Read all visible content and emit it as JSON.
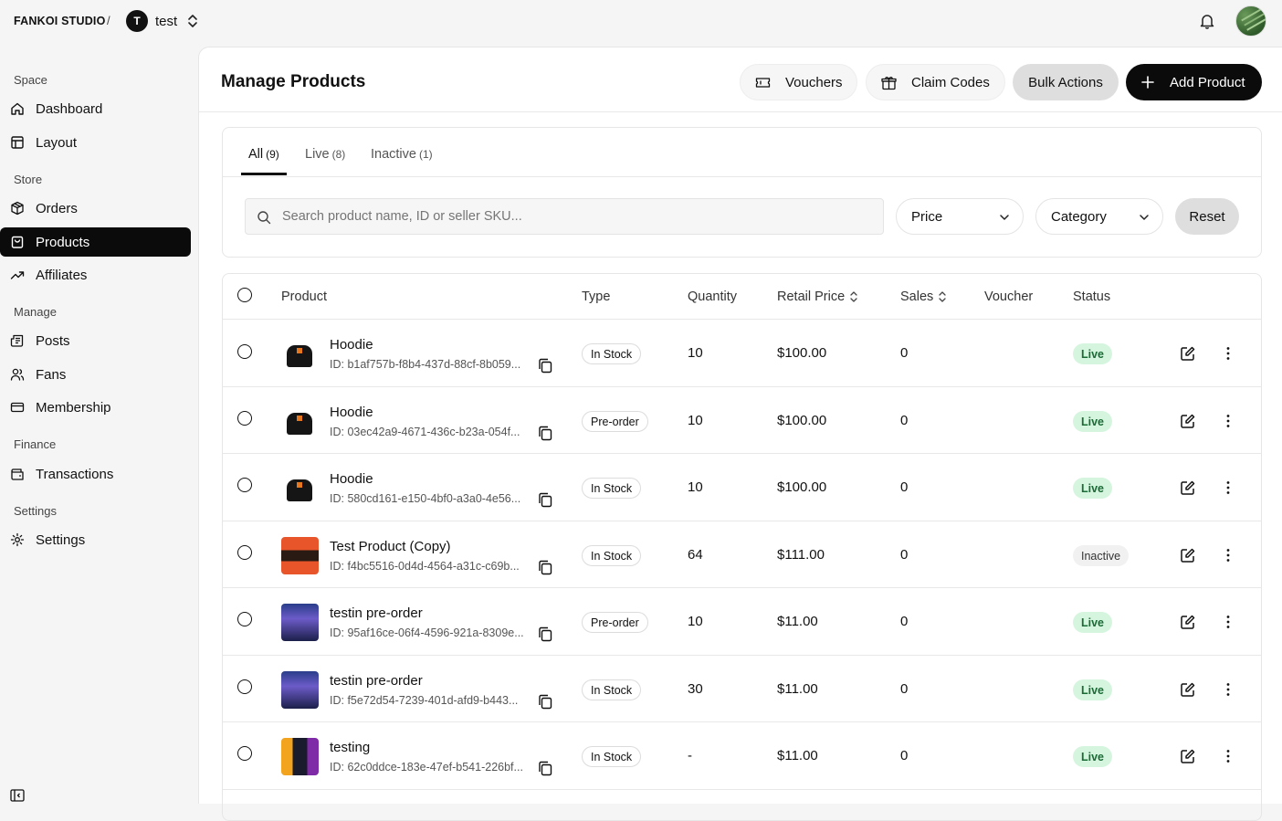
{
  "topbar": {
    "brand": "FANKOI STUDIO",
    "separator": "/",
    "space_initial": "T",
    "space_name": "test"
  },
  "sidebar": {
    "sections": [
      {
        "label": "Space"
      },
      {
        "label": "Store"
      },
      {
        "label": "Manage"
      },
      {
        "label": "Finance"
      },
      {
        "label": "Settings"
      }
    ],
    "items": [
      {
        "label": "Dashboard"
      },
      {
        "label": "Layout"
      },
      {
        "label": "Orders"
      },
      {
        "label": "Products"
      },
      {
        "label": "Affiliates"
      },
      {
        "label": "Posts"
      },
      {
        "label": "Fans"
      },
      {
        "label": "Membership"
      },
      {
        "label": "Transactions"
      },
      {
        "label": "Settings"
      }
    ]
  },
  "header": {
    "title": "Manage Products",
    "vouchers_label": "Vouchers",
    "claim_codes_label": "Claim Codes",
    "bulk_actions_label": "Bulk Actions",
    "add_product_label": "Add Product"
  },
  "tabs": [
    {
      "label": "All",
      "count": "(9)"
    },
    {
      "label": "Live",
      "count": "(8)"
    },
    {
      "label": "Inactive",
      "count": "(1)"
    }
  ],
  "filters": {
    "search_placeholder": "Search product name, ID or seller SKU...",
    "price_label": "Price",
    "category_label": "Category",
    "reset_label": "Reset"
  },
  "table": {
    "columns": {
      "product": "Product",
      "type": "Type",
      "quantity": "Quantity",
      "retail_price": "Retail Price",
      "sales": "Sales",
      "voucher": "Voucher",
      "status": "Status"
    },
    "rows": [
      {
        "name": "Hoodie",
        "id": "ID: b1af757b-f8b4-437d-88cf-8b059...",
        "type": "In Stock",
        "quantity": "10",
        "price": "$100.00",
        "sales": "0",
        "status": "Live"
      },
      {
        "name": "Hoodie",
        "id": "ID: 03ec42a9-4671-436c-b23a-054f...",
        "type": "Pre-order",
        "quantity": "10",
        "price": "$100.00",
        "sales": "0",
        "status": "Live"
      },
      {
        "name": "Hoodie",
        "id": "ID: 580cd161-e150-4bf0-a3a0-4e56...",
        "type": "In Stock",
        "quantity": "10",
        "price": "$100.00",
        "sales": "0",
        "status": "Live"
      },
      {
        "name": "Test Product (Copy)",
        "id": "ID: f4bc5516-0d4d-4564-a31c-c69b...",
        "type": "In Stock",
        "quantity": "64",
        "price": "$111.00",
        "sales": "0",
        "status": "Inactive"
      },
      {
        "name": "testin pre-order",
        "id": "ID: 95af16ce-06f4-4596-921a-8309e...",
        "type": "Pre-order",
        "quantity": "10",
        "price": "$11.00",
        "sales": "0",
        "status": "Live"
      },
      {
        "name": "testin pre-order",
        "id": "ID: f5e72d54-7239-401d-afd9-b443...",
        "type": "In Stock",
        "quantity": "30",
        "price": "$11.00",
        "sales": "0",
        "status": "Live"
      },
      {
        "name": "testing",
        "id": "ID: 62c0ddce-183e-47ef-b541-226bf...",
        "type": "In Stock",
        "quantity": "-",
        "price": "$11.00",
        "sales": "0",
        "status": "Live"
      }
    ]
  }
}
